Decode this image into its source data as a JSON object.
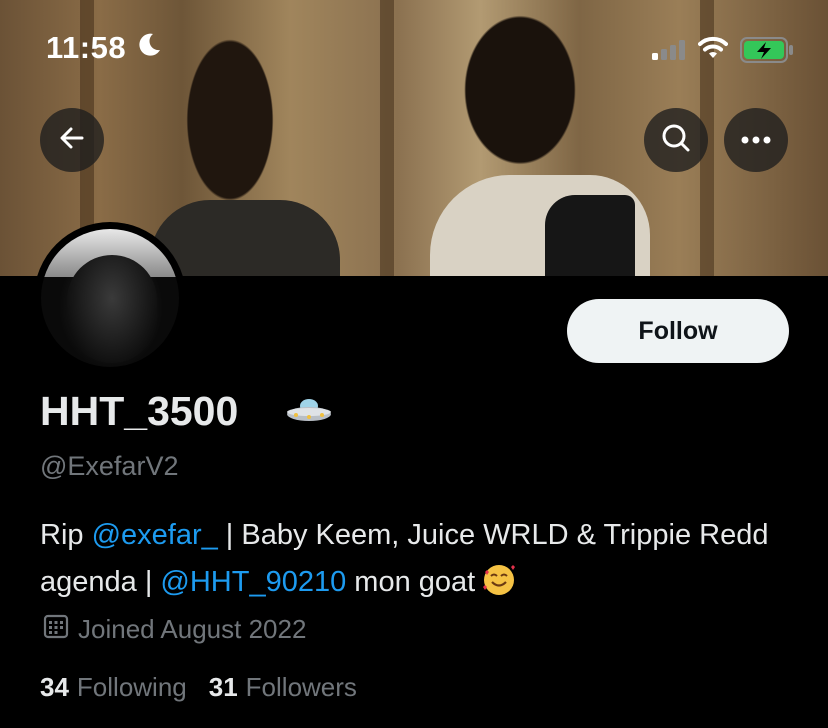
{
  "status_bar": {
    "time": "11:58",
    "icons": [
      "moon-icon",
      "signal-icon",
      "wifi-icon",
      "battery-charging-icon"
    ],
    "battery_color": "#34c759"
  },
  "header": {
    "back_icon": "arrow-left-icon",
    "search_icon": "search-icon",
    "more_icon": "more-horizontal-icon"
  },
  "profile": {
    "display_name": "HHT_3500",
    "name_emoji": "ufo-icon",
    "handle": "@ExefarV2",
    "follow_label": "Follow",
    "bio": {
      "part1": "Rip ",
      "mention1": "@exefar_",
      "part2": " | Baby Keem, Juice WRLD & Trippie Redd agenda | ",
      "mention2": "@HHT_90210",
      "part3": " mon goat",
      "emoji": "smiling-face-with-hearts-icon"
    },
    "joined": "Joined August 2022",
    "following_count": "34",
    "following_label": "Following",
    "followers_count": "31",
    "followers_label": "Followers"
  },
  "colors": {
    "accent": "#1d9bf0",
    "muted": "#71767b",
    "text": "#e7e9ea",
    "background": "#000000"
  }
}
